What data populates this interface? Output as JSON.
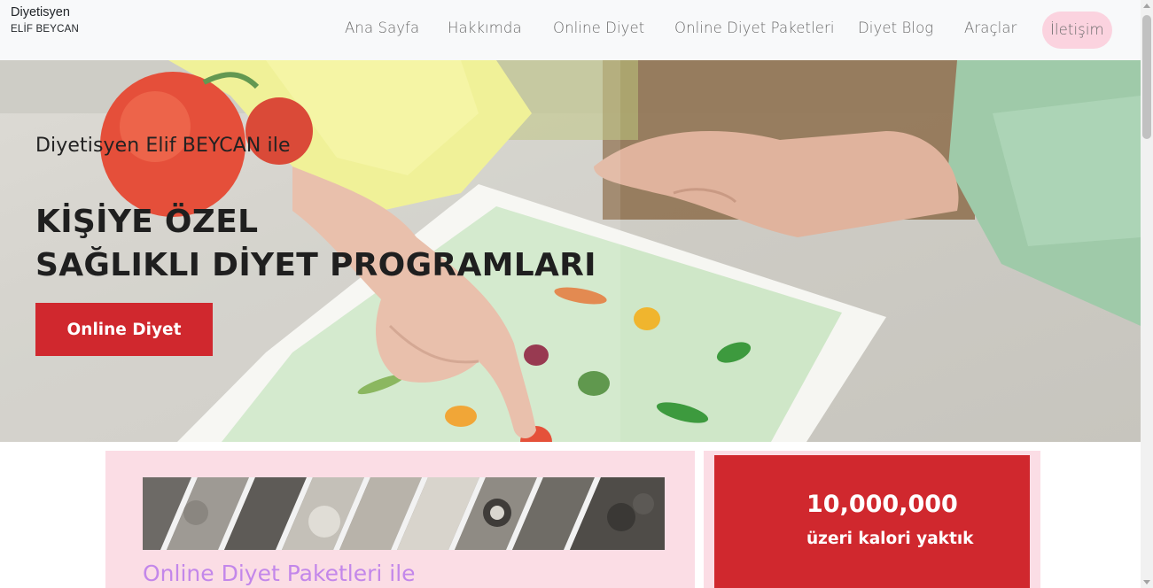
{
  "brand": {
    "title": "Diyetisyen",
    "subtitle": "ELİF BEYCAN"
  },
  "nav": {
    "items": [
      {
        "label": "Ana Sayfa"
      },
      {
        "label": "Hakkımda"
      },
      {
        "label": "Online Diyet"
      },
      {
        "label": "Online Diyet Paketleri"
      },
      {
        "label": "Diyet Blog"
      },
      {
        "label": "Araçlar"
      },
      {
        "label": "İletişim"
      }
    ]
  },
  "hero": {
    "subtitle": "Diyetisyen Elif BEYCAN ile",
    "title_line1": "KİŞİYE ÖZEL",
    "title_line2": "SAĞLIKLI DİYET PROGRAMLARI",
    "button_label": "Online Diyet"
  },
  "packages_card": {
    "title": "Online Diyet Paketleri ile"
  },
  "stat_card": {
    "value": "10,000,000",
    "label": "üzeri kalori yaktık"
  },
  "colors": {
    "accent_red": "#d0282e",
    "pink_bg": "#fbdde5",
    "contact_pill": "#fbd3df",
    "heading_purple": "#c387ea"
  }
}
